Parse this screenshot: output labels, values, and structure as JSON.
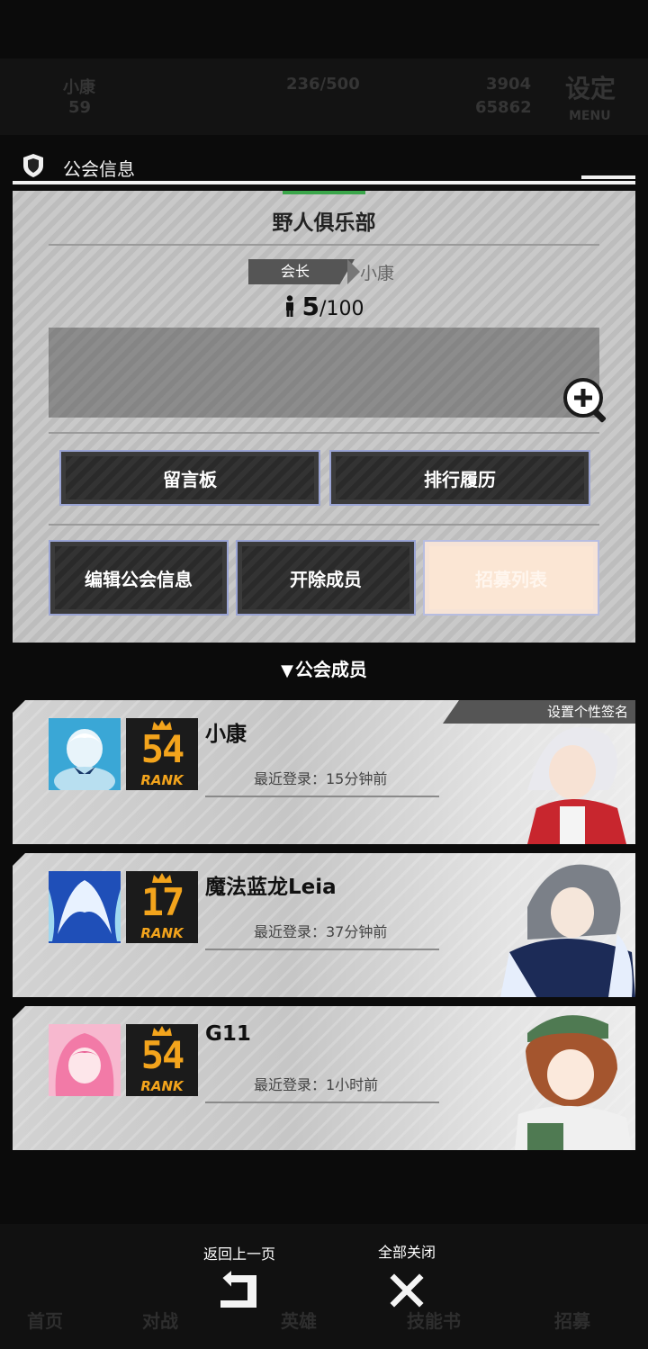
{
  "background": {
    "player_name": "小康",
    "player_level": "59",
    "stamina": "236/500",
    "currency_a": "3904",
    "currency_b": "65862",
    "settings_label": "设定",
    "menu_label": "MENU",
    "bottom_tabs": [
      "首页",
      "对战",
      "英雄",
      "技能书",
      "招募"
    ]
  },
  "header": {
    "title": "公会信息"
  },
  "guild": {
    "name": "野人俱乐部",
    "leader_tag": "会长",
    "leader_name": "小康",
    "member_count": "5",
    "member_max": "/100"
  },
  "buttons": {
    "message_board": "留言板",
    "ranking_history": "排行履历",
    "edit_info": "编辑公会信息",
    "remove_member": "开除成员",
    "recruit_list": "招募列表"
  },
  "members_heading": {
    "arrow": "▼",
    "label": "公会成员"
  },
  "members": [
    {
      "name": "小康",
      "level": "54",
      "rank_label": "RANK",
      "last_login": "最近登录：15分钟前",
      "signature_tab": "设置个性签名",
      "avatar_color": "#3aa7d6"
    },
    {
      "name": "魔法蓝龙Leia",
      "level": "17",
      "rank_label": "RANK",
      "last_login": "最近登录：37分钟前",
      "avatar_color": "#1f4fb8"
    },
    {
      "name": "G11",
      "level": "54",
      "rank_label": "RANK",
      "last_login": "最近登录：1小时前",
      "avatar_color": "#f27aa7"
    }
  ],
  "nav": {
    "back_label": "返回上一页",
    "close_all_label": "全部关闭"
  }
}
